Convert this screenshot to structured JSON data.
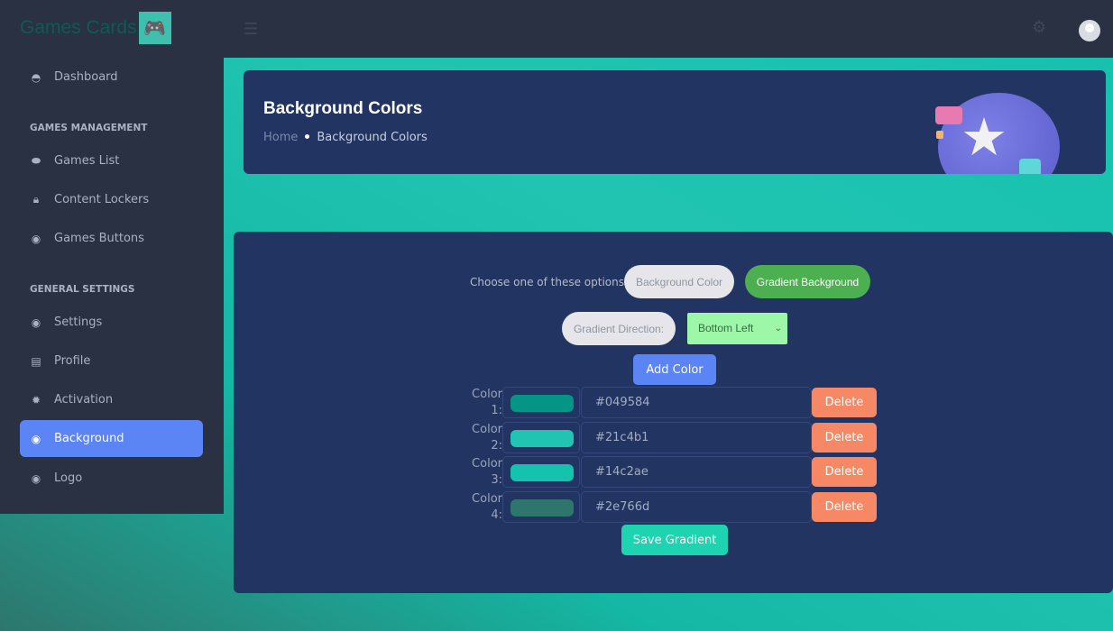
{
  "app": {
    "title": "Games Cards"
  },
  "sidebar": {
    "items": [
      {
        "label": "Dashboard",
        "icon": "dashboard-icon"
      },
      {
        "label": "Games List",
        "icon": "gamepad-icon"
      },
      {
        "label": "Content Lockers",
        "icon": "lock-icon"
      },
      {
        "label": "Games Buttons",
        "icon": "toggle-icon"
      },
      {
        "label": "Settings",
        "icon": "toggle-icon"
      },
      {
        "label": "Profile",
        "icon": "id-card-icon"
      },
      {
        "label": "Activation",
        "icon": "badge-icon"
      },
      {
        "label": "Background",
        "icon": "toggle-icon",
        "active": true
      },
      {
        "label": "Logo",
        "icon": "toggle-icon"
      }
    ],
    "sections": [
      "GAMES MANAGEMENT",
      "GENERAL SETTINGS"
    ]
  },
  "header": {
    "title": "Background Colors",
    "breadcrumb": [
      "Home",
      "Background Colors"
    ]
  },
  "form": {
    "choose_label": "Choose one of these options:",
    "option_bg": "Background Color",
    "option_gradient": "Gradient Background",
    "direction_label": "Gradient Direction:",
    "direction_value": "Bottom Left",
    "add_color": "Add Color",
    "colors": [
      {
        "label": "Color",
        "num": "1:",
        "hex": "#049584"
      },
      {
        "label": "Color",
        "num": "2:",
        "hex": "#21c4b1"
      },
      {
        "label": "Color",
        "num": "3:",
        "hex": "#14c2ae"
      },
      {
        "label": "Color",
        "num": "4:",
        "hex": "#2e766d"
      }
    ],
    "delete_label": "Delete",
    "save": "Save Gradient"
  },
  "colors": {
    "accent": "#5b84f4",
    "gradient_button": "#4caf50",
    "delete": "#f78865",
    "save": "#1dd3b0"
  }
}
